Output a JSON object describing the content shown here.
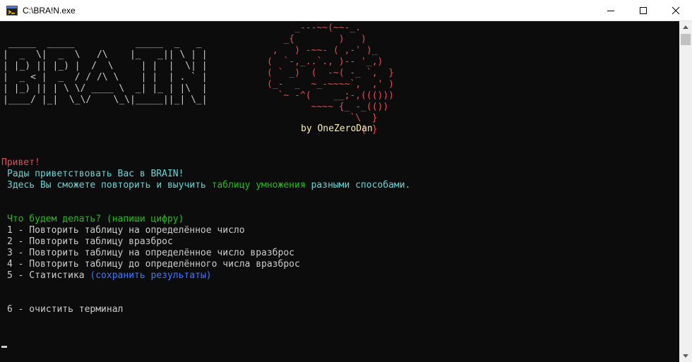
{
  "window": {
    "title": "C:\\BRA!N.exe"
  },
  "banner": {
    "logo_art": " _____  _____           _____  _   _ \n|  _  \\|  _  \\   /\\    |_   _|| \\ | |\n| |_) || |_) |  /  \\     | |  |  \\| |\n|  _ < |  _  / / /\\ \\    | |  | . ` |\n| |_) || | \\ \\/ ____ \\  _| |_ | |\\  |\n|____/ |_|  \\_\\/    \\_\\|_____||_| \\_|",
    "brain_art": "     _---~~(~~-_.\n   _{        )   )\n ,   ) -~~- ( ,-' )_\n(  `-,_..`., )-- '_,)\n( ` _)  (  -~( -_ `,  }\n(_-  _  ~_-~~~~`,  ,' )\n  `~ -^(    __;-,((()))\n        ~~~~ {_ -_(())\n               `\\  }\n                 { }",
    "author": "by OneZeroDan"
  },
  "greeting": {
    "hello": "Привет!",
    "welcome": "Рады приветствовать Вас в BRAIN!",
    "desc_before": "Здесь Вы сможете повторить и выучить ",
    "desc_highlight": "таблицу умножения",
    "desc_after": " разными способами."
  },
  "menu": {
    "prompt": "Что будем делать? (напиши цифру)",
    "items": [
      "1 - Повторить таблицу на определённое число",
      "2 - Повторить таблицу вразброс",
      "3 - Повторить таблицу на определённое число вразброс",
      "4 - Повторить таблицу до определённого числа вразброс"
    ],
    "item5_text": "5 - Статистика ",
    "item5_note": "(сохранить результаты)",
    "item6": "6 - очистить терминал"
  },
  "colors": {
    "background": "#0c0c0c",
    "red": "#e74856",
    "cyan": "#61d6d6",
    "green": "#16c60c",
    "blue": "#3b78ff"
  }
}
